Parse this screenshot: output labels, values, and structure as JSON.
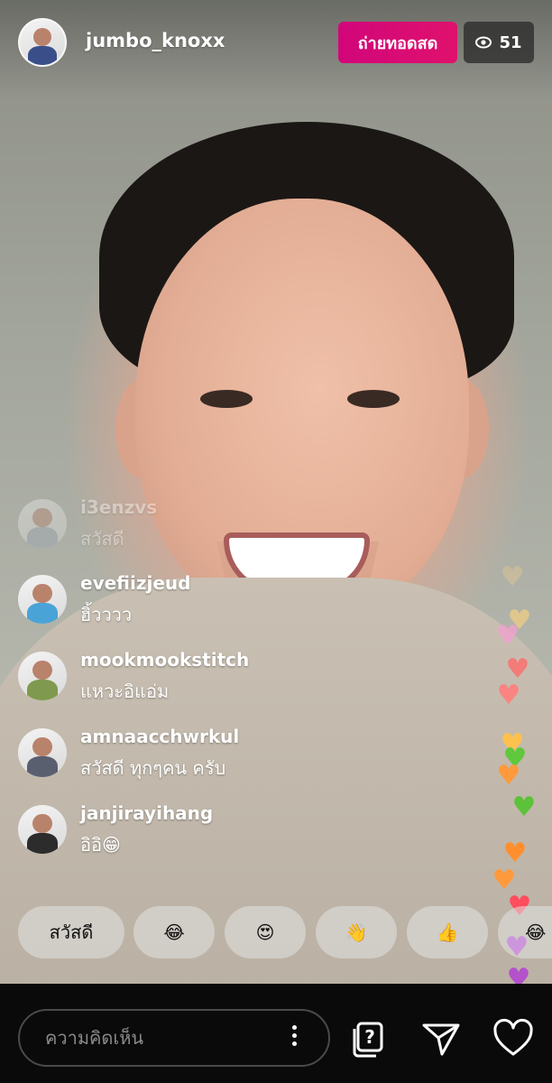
{
  "header": {
    "username": "jumbo_knoxx",
    "live_label": "ถ่ายทอดสด",
    "viewer_count": "51",
    "viewer_icon": "eye-icon"
  },
  "comments": [
    {
      "user": "i3enzvs",
      "text": "สวัสดี"
    },
    {
      "user": "evefiizjeud",
      "text": "ฮิ้วววว"
    },
    {
      "user": "mookmookstitch",
      "text": "แหวะอิแอ่ม"
    },
    {
      "user": "amnaacchwrkul",
      "text": "สวัสดี ทุกๆคน ครับ"
    },
    {
      "user": "janjirayihang",
      "text": "อิอิ😁"
    }
  ],
  "quick_replies": [
    "สวัสดี",
    "😂",
    "😍",
    "👋",
    "👍",
    "😂"
  ],
  "bottom_bar": {
    "comment_placeholder": "ความคิดเห็น",
    "icons": [
      "more-vertical-icon",
      "question-sticker-icon",
      "send-icon",
      "heart-icon"
    ]
  },
  "heart_colors": [
    "#f4cf8c",
    "#ffd37a",
    "#f4a0d0",
    "#ff6b6b",
    "#ff7e7e",
    "#ffc14d",
    "#5fc83c",
    "#ff9a3c",
    "#5cc23a",
    "#ff8f2e",
    "#ff9a3c",
    "#ff4d5e",
    "#b23bd4",
    "#b23bd4"
  ]
}
